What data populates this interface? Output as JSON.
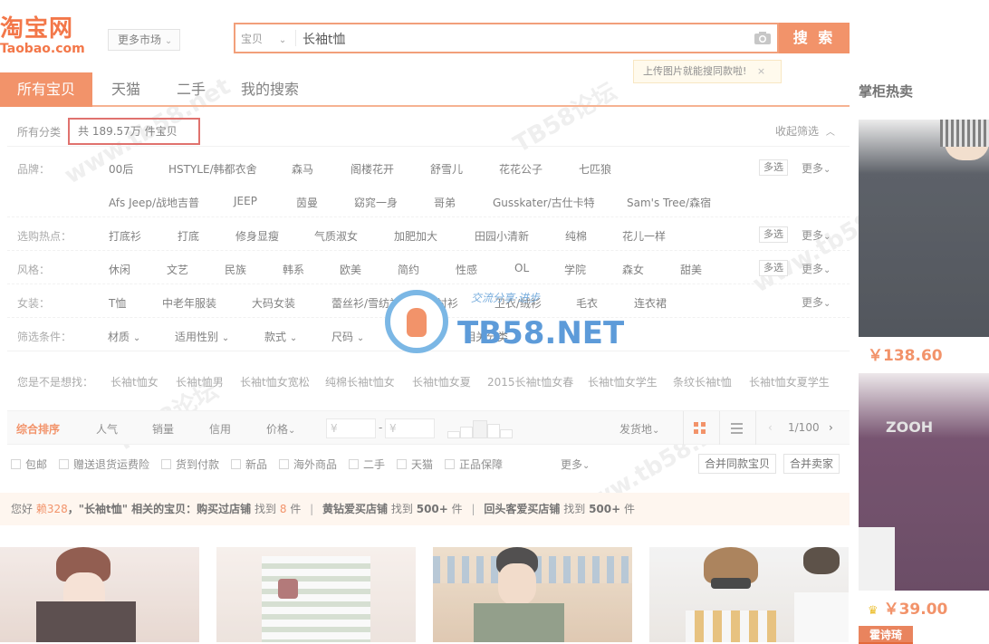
{
  "logo": {
    "main": "淘宝网",
    "sub": "Taobao.com"
  },
  "market_button": "更多市场",
  "search": {
    "category": "宝贝",
    "value": "长袖t恤",
    "button": "搜 索"
  },
  "upload_tip": {
    "text": "上传图片就能搜同款啦!",
    "close": "×"
  },
  "tabs": [
    "所有宝贝",
    "天猫",
    "二手",
    "我的搜索"
  ],
  "right_panel": {
    "title": "掌柜热卖",
    "products": [
      {
        "price": "￥138.60"
      },
      {
        "price": "￥39.00"
      }
    ],
    "badge": "霍诗琦"
  },
  "filter": {
    "crumb_label": "所有分类",
    "count": "共 189.57万 件宝贝",
    "collapse": "收起筛选",
    "multi_label": "多选",
    "more_label": "更多",
    "rows": [
      {
        "label": "品牌：",
        "items": [
          "00后",
          "HSTYLE/韩都衣舍",
          "森马",
          "阁楼花开",
          "舒雪儿",
          "花花公子",
          "七匹狼"
        ]
      },
      {
        "label": "",
        "items": [
          "Afs Jeep/战地吉普",
          "JEEP",
          "茵曼",
          "窈窕一身",
          "哥弟",
          "Gusskater/古仕卡特",
          "Sam's Tree/森宿"
        ]
      },
      {
        "label": "选购热点：",
        "items": [
          "打底衫",
          "打底",
          "修身显瘦",
          "气质淑女",
          "加肥加大",
          "田园小清新",
          "纯棉",
          "花儿一样"
        ]
      },
      {
        "label": "风格：",
        "items": [
          "休闲",
          "文艺",
          "民族",
          "韩系",
          "欧美",
          "简约",
          "性感",
          "OL",
          "学院",
          "森女",
          "甜美"
        ]
      },
      {
        "label": "女装：",
        "items": [
          "T恤",
          "中老年服装",
          "大码女装",
          "蕾丝衫/雪纺衫",
          "衬衫",
          "卫衣/绒衫",
          "毛衣",
          "连衣裙"
        ]
      }
    ],
    "conditions": {
      "label": "筛选条件：",
      "items": [
        "材质",
        "适用性别",
        "款式",
        "尺码",
        "衣长",
        "相关分类"
      ]
    },
    "suggest": {
      "label": "您是不是想找：",
      "items": [
        "长袖t恤女",
        "长袖t恤男",
        "长袖t恤女宽松",
        "纯棉长袖t恤女",
        "长袖t恤女夏",
        "2015长袖t恤女春",
        "长袖t恤女学生",
        "条纹长袖t恤",
        "长袖t恤女夏学生"
      ]
    }
  },
  "sort": {
    "items": [
      "综合排序",
      "人气",
      "销量",
      "信用",
      "价格"
    ],
    "price_from": "¥",
    "price_to": "¥",
    "price_dash": "-",
    "location": "发货地",
    "page": "1/100"
  },
  "checks": {
    "items": [
      "包邮",
      "赠送退货运费险",
      "货到付款",
      "新品",
      "海外商品",
      "二手",
      "天猫",
      "正品保障"
    ],
    "more": "更多",
    "merge_same": "合并同款宝贝",
    "merge_seller": "合并卖家"
  },
  "info_bar": {
    "greeting": "您好",
    "user": "赖328",
    "query_part": "，\"长袖t恤\" 相关的宝贝：",
    "seg1_label": "购买过店铺",
    "seg1_pre": "找到",
    "seg1_count": "8",
    "seg1_unit": "件",
    "seg2_label": "黄钻爱买店铺",
    "seg2_pre": "找到",
    "seg2_count": "500+",
    "seg2_unit": "件",
    "seg3_label": "回头客爱买店铺",
    "seg3_pre": "找到",
    "seg3_count": "500+",
    "seg3_unit": "件"
  },
  "watermark": {
    "text": "TB58.NET",
    "sub": "交流分享·进步"
  },
  "colors": {
    "accent": "#f07c4a",
    "border": "#f5a27a",
    "highlight": "#d9534f"
  }
}
